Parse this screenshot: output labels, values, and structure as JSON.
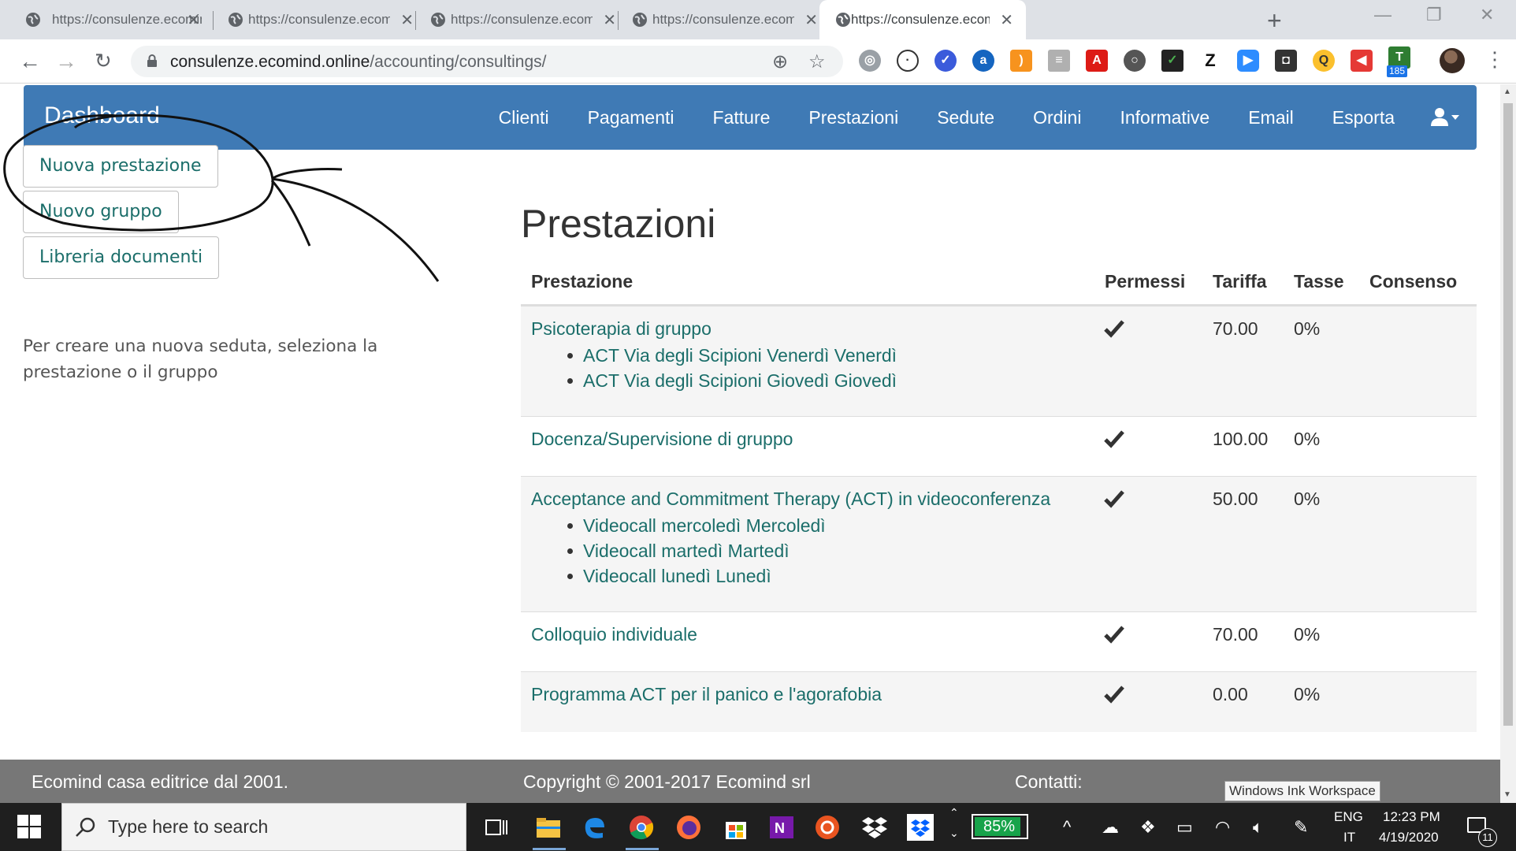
{
  "browser": {
    "tabs": [
      {
        "title": "https://consulenze.ecomind.online/accounting/consultings/"
      },
      {
        "title": "https://consulenze.ecomind.online/accounting/consultings/"
      },
      {
        "title": "https://consulenze.ecomind.online/accounting/consultings/"
      },
      {
        "title": "https://consulenze.ecomind.online/accounting/consultings/"
      },
      {
        "title": "https://consulenze.ecomind.online/accounting/consultings/"
      }
    ],
    "url_host": "consulenze.ecomind.online",
    "url_path": "/accounting/consultings/",
    "extension_badge": "185"
  },
  "navbar": {
    "brand": "Dashboard",
    "links": [
      "Clienti",
      "Pagamenti",
      "Fatture",
      "Prestazioni",
      "Sedute",
      "Ordini",
      "Informative",
      "Email",
      "Esporta"
    ]
  },
  "sidebar": {
    "new_service": "Nuova prestazione",
    "new_group": "Nuovo gruppo",
    "doc_library": "Libreria documenti",
    "help": "Per creare una nuova seduta, seleziona la prestazione o il gruppo"
  },
  "main": {
    "title": "Prestazioni",
    "columns": [
      "Prestazione",
      "Permessi",
      "Tariffa",
      "Tasse",
      "Consenso"
    ],
    "rows": [
      {
        "name": "Psicoterapia di gruppo",
        "groups": [
          "ACT Via degli Scipioni Venerdì Venerdì",
          "ACT Via degli Scipioni Giovedì Giovedì"
        ],
        "rate": "70.00",
        "tax": "0%"
      },
      {
        "name": "Docenza/Supervisione di gruppo",
        "groups": [],
        "rate": "100.00",
        "tax": "0%"
      },
      {
        "name": "Acceptance and Commitment Therapy (ACT) in videoconferenza",
        "groups": [
          "Videocall mercoledì Mercoledì",
          "Videocall martedì Martedì",
          "Videocall lunedì Lunedì"
        ],
        "rate": "50.00",
        "tax": "0%"
      },
      {
        "name": "Colloquio individuale",
        "groups": [],
        "rate": "70.00",
        "tax": "0%"
      },
      {
        "name": "Programma ACT per il panico e l'agorafobia",
        "groups": [],
        "rate": "0.00",
        "tax": "0%"
      }
    ]
  },
  "footer": {
    "left": "Ecomind casa editrice dal 2001.",
    "center": "Copyright © 2001-2017 Ecomind srl",
    "right": "Contatti:"
  },
  "tooltip": "Windows Ink Workspace",
  "taskbar": {
    "search_placeholder": "Type here to search",
    "battery": "85%",
    "lang_top": "ENG",
    "lang_bottom": "IT",
    "time": "12:23 PM",
    "date": "4/19/2020",
    "notifications": "11"
  },
  "colors": {
    "navbar": "#3f7ab5",
    "link": "#1b6e6a",
    "footer": "#777777"
  }
}
